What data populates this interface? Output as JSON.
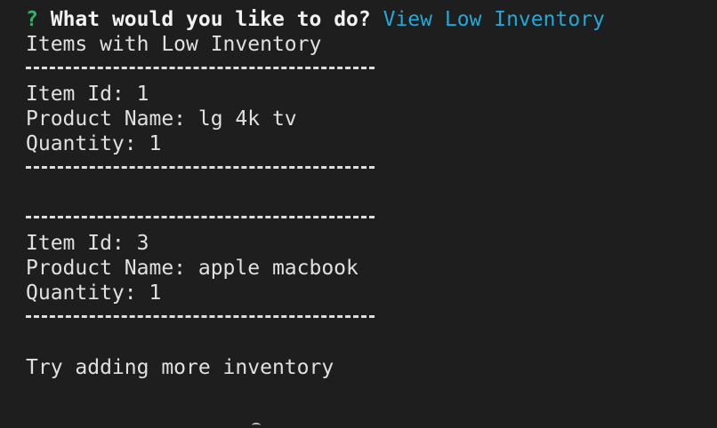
{
  "terminal": {
    "prompt_mark": "?",
    "prompt_question": "What would you like to do?",
    "prompt_answer": "View Low Inventory",
    "heading": "Items with Low Inventory",
    "items": [
      {
        "id_line": "Item Id: 1",
        "name_line": "Product Name: lg 4k tv",
        "qty_line": "Quantity: 1"
      },
      {
        "id_line": "Item Id: 3",
        "name_line": "Product Name: apple macbook",
        "qty_line": "Quantity: 1"
      }
    ],
    "footer_message": "Try adding more inventory"
  }
}
